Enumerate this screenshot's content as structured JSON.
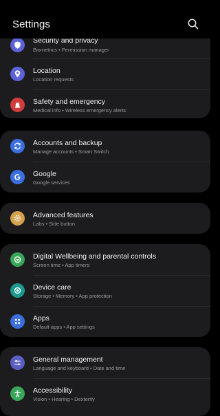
{
  "header": {
    "title": "Settings",
    "search_icon": "search-icon"
  },
  "colors": {
    "background": "#000000",
    "card": "#1c1c1e",
    "security": "#5c63d6",
    "location": "#5c63d6",
    "safety": "#d13b3b",
    "accounts": "#3b6fe0",
    "google": "#3b6fe0",
    "advanced": "#d4a24c",
    "wellbeing": "#3aa65a",
    "device_care": "#1c9a8f",
    "apps": "#3b6fe0",
    "general": "#5a5fc4",
    "accessibility": "#3aa65a"
  },
  "groups": [
    {
      "items": [
        {
          "label": "Security and privacy",
          "sub": "Biometrics • Permission manager",
          "icon": "shield-icon"
        },
        {
          "label": "Location",
          "sub": "Location requests",
          "icon": "location-pin-icon"
        },
        {
          "label": "Safety and emergency",
          "sub": "Medical info • Wireless emergency alerts",
          "icon": "emergency-light-icon"
        }
      ]
    },
    {
      "items": [
        {
          "label": "Accounts and backup",
          "sub": "Manage accounts • Smart Switch",
          "icon": "sync-icon"
        },
        {
          "label": "Google",
          "sub": "Google services",
          "icon": "google-icon"
        }
      ]
    },
    {
      "items": [
        {
          "label": "Advanced features",
          "sub": "Labs • Side button",
          "icon": "gear-star-icon"
        }
      ]
    },
    {
      "items": [
        {
          "label": "Digital Wellbeing and parental controls",
          "sub": "Screen time • App timers",
          "icon": "wellbeing-icon"
        },
        {
          "label": "Device care",
          "sub": "Storage • Memory • App protection",
          "icon": "device-care-icon"
        },
        {
          "label": "Apps",
          "sub": "Default apps • App settings",
          "icon": "apps-grid-icon"
        }
      ]
    },
    {
      "items": [
        {
          "label": "General management",
          "sub": "Language and keyboard • Date and time",
          "icon": "sliders-icon"
        },
        {
          "label": "Accessibility",
          "sub": "Vision • Hearing • Dexterity",
          "icon": "accessibility-icon"
        }
      ]
    }
  ]
}
